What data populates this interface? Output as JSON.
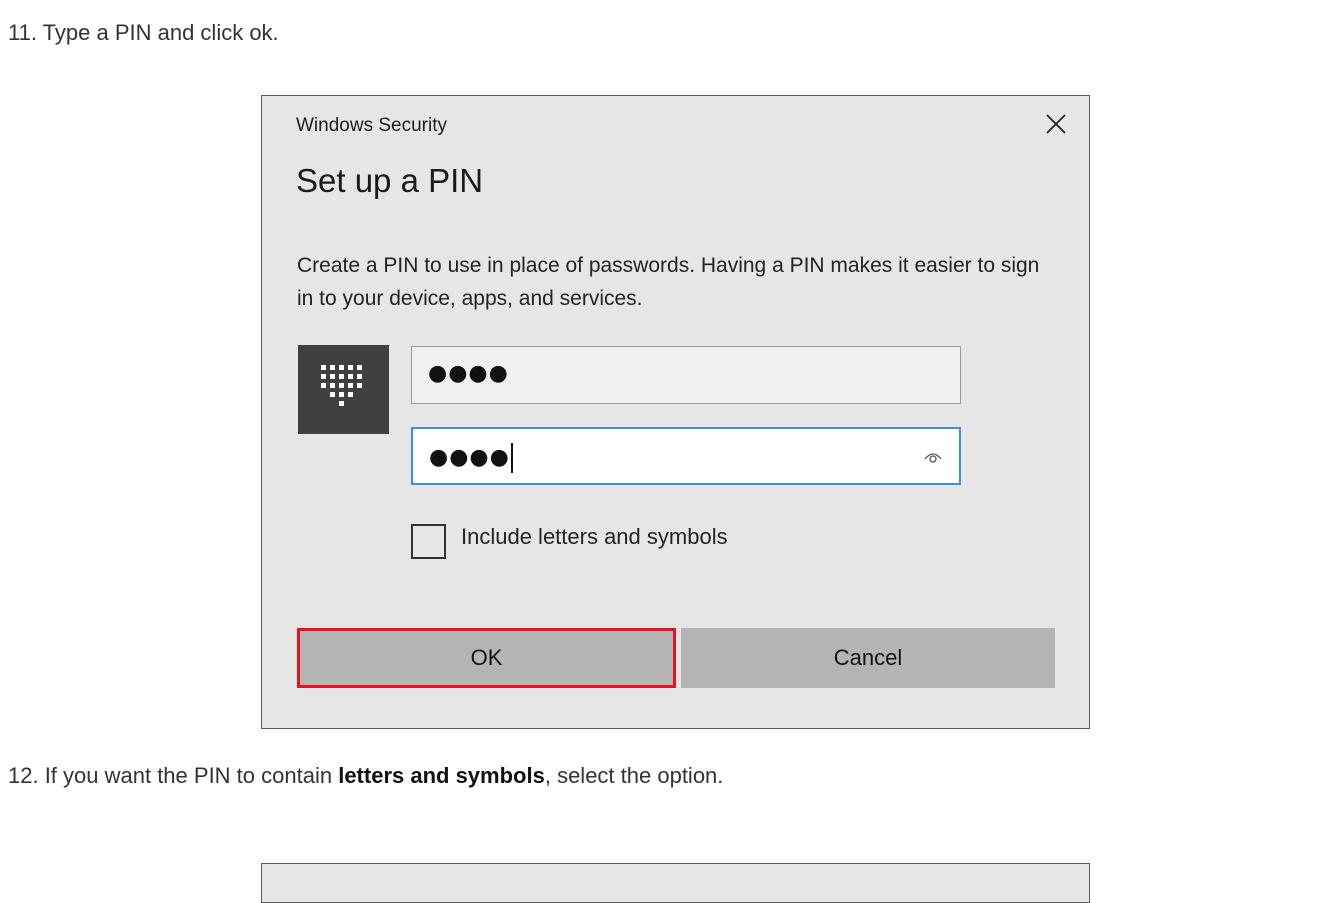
{
  "steps": {
    "step11": "11. Type a PIN and click ok.",
    "step12_prefix": "12. If you want the PIN to contain ",
    "step12_bold": "letters and symbols",
    "step12_suffix": ", select the option."
  },
  "dialog": {
    "caption": "Windows Security",
    "title": "Set up a PIN",
    "description": "Create a PIN to use in place of passwords. Having a PIN makes it easier to sign in to your device, apps, and services.",
    "pin_value": "●●●●",
    "confirm_value": "●●●●",
    "checkbox_label": "Include letters and symbols",
    "checkbox_checked": false,
    "ok_label": "OK",
    "cancel_label": "Cancel",
    "icons": {
      "close": "close-icon",
      "keypad": "keypad-icon",
      "reveal": "eye-icon"
    },
    "colors": {
      "highlight": "#e81123",
      "focus_border": "#3b8fdc",
      "background": "#e6e6e6",
      "button": "#b4b4b4"
    }
  }
}
